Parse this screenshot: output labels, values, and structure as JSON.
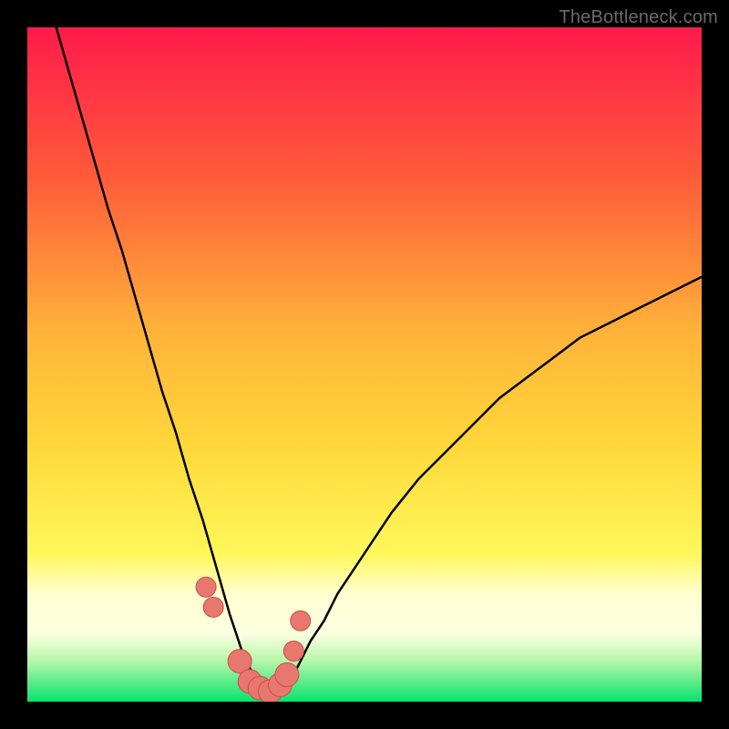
{
  "watermark": "TheBottleneck.com",
  "colors": {
    "bg": "#000000",
    "curve": "#000000",
    "marker_fill": "#e8776f",
    "marker_stroke": "#c9504a",
    "gradient_top": "#ff1a4b",
    "gradient_mid_upper": "#ff7a2b",
    "gradient_mid": "#ffd83a",
    "gradient_mid_lower": "#fff75a",
    "gradient_band": "#ffffd0",
    "gradient_bottom": "#08e26e"
  },
  "chart_data": {
    "type": "line",
    "title": "",
    "xlabel": "",
    "ylabel": "",
    "xlim": [
      0,
      100
    ],
    "ylim": [
      0,
      100
    ],
    "x": [
      0,
      2,
      4,
      6,
      8,
      10,
      12,
      14,
      16,
      18,
      20,
      22,
      24,
      26,
      28,
      30,
      31,
      32,
      33,
      34,
      35,
      36,
      37,
      38,
      39,
      40,
      42,
      44,
      46,
      48,
      50,
      54,
      58,
      62,
      66,
      70,
      74,
      78,
      82,
      86,
      90,
      94,
      98,
      100
    ],
    "values": [
      115,
      108,
      101,
      94,
      87,
      80,
      73,
      67,
      60,
      53,
      46,
      40,
      33,
      27,
      20,
      13,
      10,
      7,
      5,
      3,
      2,
      1,
      1,
      2,
      3,
      5,
      9,
      12,
      16,
      19,
      22,
      28,
      33,
      37,
      41,
      45,
      48,
      51,
      54,
      56,
      58,
      60,
      62,
      63
    ],
    "markers": {
      "x": [
        26.5,
        27.6,
        31.5,
        33.0,
        34.5,
        36.0,
        37.5,
        38.5,
        39.5,
        40.5
      ],
      "y": [
        17.0,
        14.0,
        6.0,
        3.0,
        2.0,
        1.5,
        2.5,
        4.0,
        7.5,
        12.0
      ]
    }
  }
}
